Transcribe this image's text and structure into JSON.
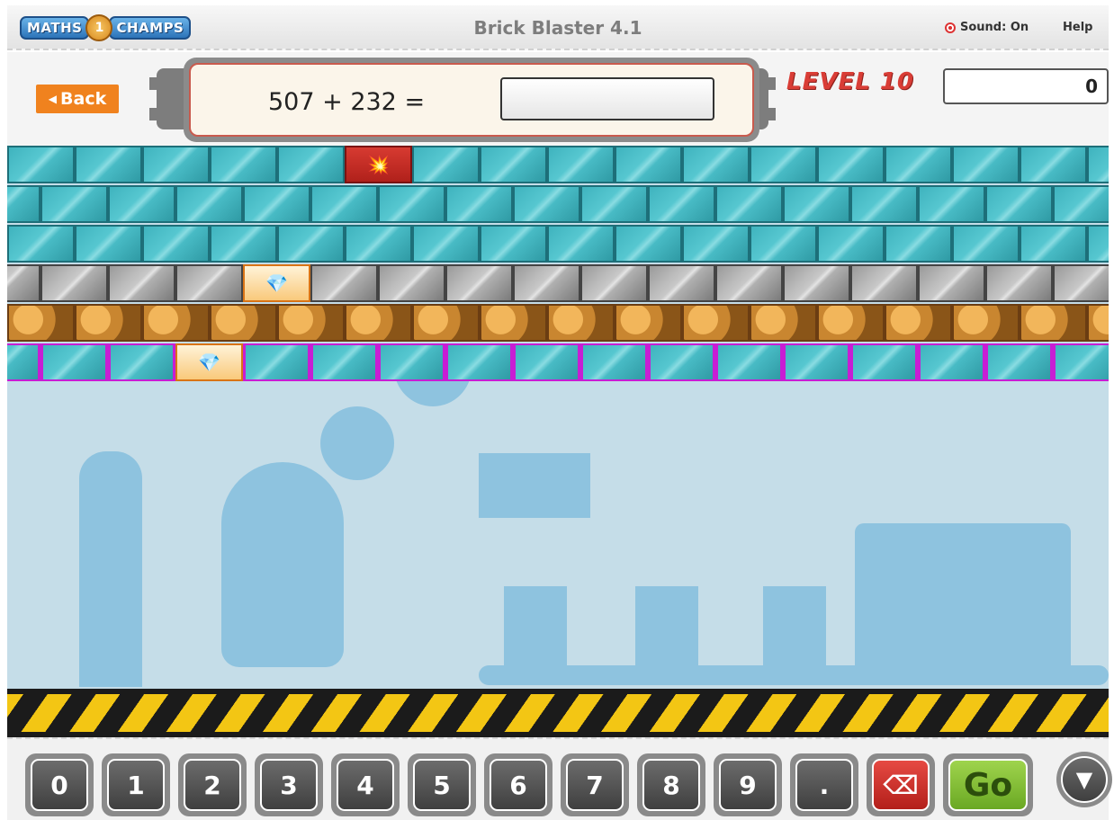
{
  "app": {
    "logo_left": "MATHS",
    "logo_mid": "1",
    "logo_right": "CHAMPS",
    "title": "Brick Blaster 4.1",
    "sound_label": "Sound: On",
    "help_label": "Help"
  },
  "question": {
    "back_label": "Back",
    "text": "507 + 232 =",
    "answer_value": "",
    "level_label": "LEVEL 10",
    "score": "0"
  },
  "bricks": {
    "rows": [
      {
        "style": "teal",
        "count": 17,
        "offset": 0,
        "specials": [
          {
            "index": 5,
            "kind": "red",
            "icon": "explosion-icon"
          }
        ]
      },
      {
        "style": "teal",
        "count": 17,
        "offset": -38,
        "specials": []
      },
      {
        "style": "teal",
        "count": 17,
        "offset": 0,
        "specials": []
      },
      {
        "style": "grey",
        "count": 17,
        "offset": -38,
        "specials": [
          {
            "index": 4,
            "kind": "gem",
            "icon": "diamond-icon"
          }
        ]
      },
      {
        "style": "rock",
        "count": 17,
        "offset": 0,
        "specials": []
      },
      {
        "style": "purple",
        "count": 17,
        "offset": -38,
        "specials": [
          {
            "index": 3,
            "kind": "gem",
            "icon": "diamond-icon"
          }
        ]
      }
    ]
  },
  "keypad": {
    "keys": [
      "0",
      "1",
      "2",
      "3",
      "4",
      "5",
      "6",
      "7",
      "8",
      "9",
      "."
    ],
    "delete_icon": "backspace-icon",
    "go_label": "Go",
    "menu_icon": "chevron-down-icon"
  },
  "colors": {
    "accent_orange": "#f0821e",
    "level_red": "#d93d36",
    "brick_teal": "#3fb3be",
    "go_green": "#8cc63f",
    "delete_red": "#d9322b",
    "playfield_bg": "#c5dde8"
  }
}
